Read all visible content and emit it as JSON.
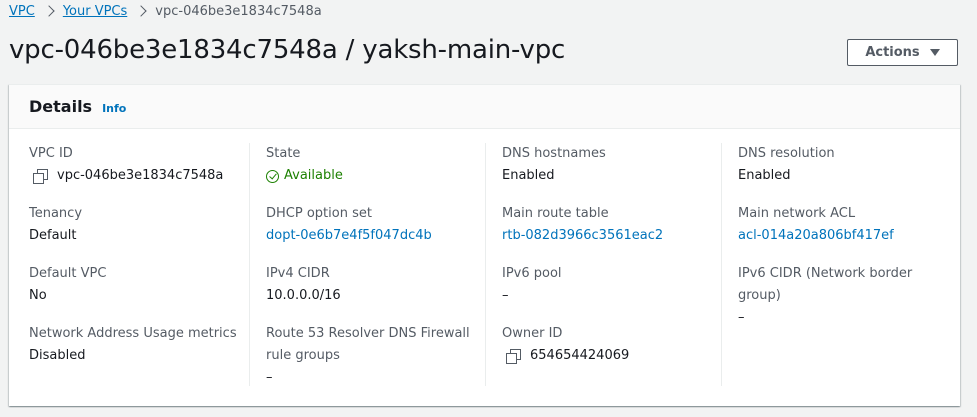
{
  "breadcrumb": {
    "items": [
      {
        "label": "VPC"
      },
      {
        "label": "Your VPCs"
      }
    ],
    "current": "vpc-046be3e1834c7548a"
  },
  "page": {
    "title": "vpc-046be3e1834c7548a / yaksh-main-vpc"
  },
  "actions": {
    "label": "Actions"
  },
  "details": {
    "title": "Details",
    "info_label": "Info",
    "columns": [
      [
        {
          "label": "VPC ID",
          "value": "vpc-046be3e1834c7548a"
        },
        {
          "label": "Tenancy",
          "value": "Default"
        },
        {
          "label": "Default VPC",
          "value": "No"
        },
        {
          "label": "Network Address Usage metrics",
          "value": "Disabled"
        }
      ],
      [
        {
          "label": "State",
          "value": "Available"
        },
        {
          "label": "DHCP option set",
          "value": "dopt-0e6b7e4f5f047dc4b"
        },
        {
          "label": "IPv4 CIDR",
          "value": "10.0.0.0/16"
        },
        {
          "label": "Route 53 Resolver DNS Firewall rule groups",
          "value": "–"
        }
      ],
      [
        {
          "label": "DNS hostnames",
          "value": "Enabled"
        },
        {
          "label": "Main route table",
          "value": "rtb-082d3966c3561eac2"
        },
        {
          "label": "IPv6 pool",
          "value": "–"
        },
        {
          "label": "Owner ID",
          "value": "654654424069"
        }
      ],
      [
        {
          "label": "DNS resolution",
          "value": "Enabled"
        },
        {
          "label": "Main network ACL",
          "value": "acl-014a20a806bf417ef"
        },
        {
          "label": "IPv6 CIDR (Network border group)",
          "value": "–"
        }
      ]
    ]
  }
}
